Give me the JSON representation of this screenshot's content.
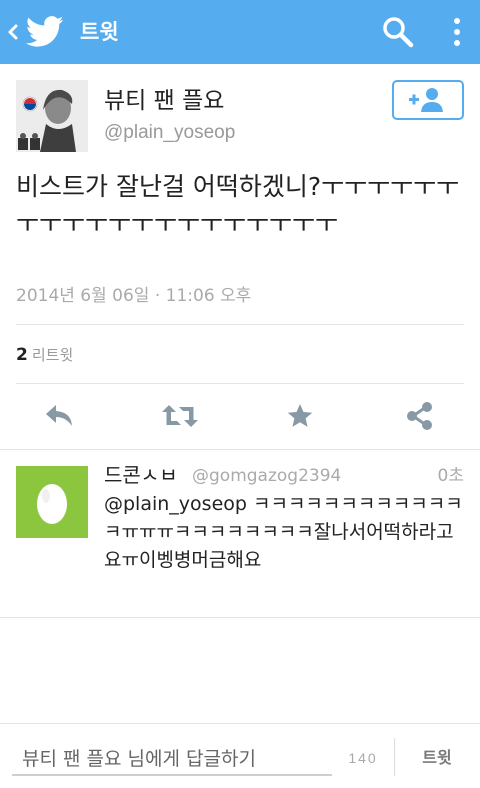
{
  "colors": {
    "accent": "#55acee",
    "avatar_bg": "#8cc63f",
    "text": "#222222",
    "muted": "#999999"
  },
  "header": {
    "title": "트윗"
  },
  "author": {
    "name": "뷰티 팬 플요",
    "handle": "@plain_yoseop"
  },
  "tweet": {
    "text": "비스트가 잘난걸 어떡하겠니?ㅜㅜㅜㅜㅜㅜㅜㅜㅜㅜㅜㅜㅜㅜㅜㅜㅜㅜㅜㅜ",
    "timestamp": "2014년 6월 06일 · 11:06 오후"
  },
  "stats": {
    "retweet_count": "2",
    "retweet_label": "리트윗"
  },
  "actions": [
    "reply-icon",
    "retweet-icon",
    "favorite-icon",
    "share-icon"
  ],
  "reply": {
    "name": "드콘ㅅㅂ",
    "handle": "@gomgazog2394",
    "time": "0초",
    "text": "@plain_yoseop ㅋㅋㅋㅋㅋㅋㅋㅋㅋㅋㅋㅋㅋㅠㅠㅠㅋㅋㅋㅋㅋㅋㅋㅋ잘나서어떡하라고요ㅠ이벵병머금해요"
  },
  "composer": {
    "placeholder": "뷰티 팬 플요 님에게 답글하기",
    "char_count": "140",
    "send_label": "트윗"
  }
}
